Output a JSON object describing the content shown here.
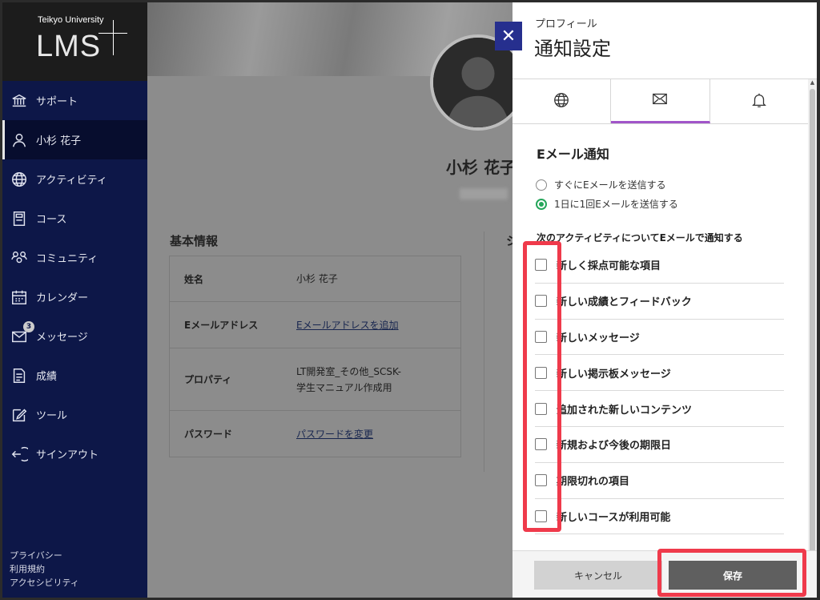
{
  "logo": {
    "small": "Teikyo University",
    "big": "LMS"
  },
  "sidebar": {
    "items": [
      {
        "label": "サポート",
        "icon": "institution-icon"
      },
      {
        "label": "小杉 花子",
        "icon": "user-icon"
      },
      {
        "label": "アクティビティ",
        "icon": "globe-icon"
      },
      {
        "label": "コース",
        "icon": "course-icon"
      },
      {
        "label": "コミュニティ",
        "icon": "community-icon"
      },
      {
        "label": "カレンダー",
        "icon": "calendar-icon"
      },
      {
        "label": "メッセージ",
        "icon": "mail-icon",
        "badge": "3"
      },
      {
        "label": "成績",
        "icon": "grades-icon"
      },
      {
        "label": "ツール",
        "icon": "tools-icon"
      },
      {
        "label": "サインアウト",
        "icon": "signout-icon"
      }
    ],
    "footer": [
      "プライバシー",
      "利用規約",
      "アクセシビリティ"
    ]
  },
  "profile": {
    "name": "小杉 花子",
    "section_title": "基本情報",
    "section_title_2": "シ",
    "rows": [
      {
        "label": "姓名",
        "value": "小杉 花子"
      },
      {
        "label": "Eメールアドレス",
        "value": "Eメールアドレスを追加"
      },
      {
        "label": "プロパティ",
        "value": "LT開発室_その他_SCSK-学生マニュアル作成用"
      },
      {
        "label": "パスワード",
        "value": "パスワードを変更"
      }
    ]
  },
  "panel": {
    "close": "✕",
    "subtitle": "プロフィール",
    "title": "通知設定",
    "tabs": [
      "globe-icon",
      "envelope-icon",
      "bell-icon"
    ],
    "active_tab": 1,
    "email_heading": "Eメール通知",
    "radio_options": [
      "すぐにEメールを送信する",
      "1日に1回Eメールを送信する"
    ],
    "radio_selected": 1,
    "activity_heading": "次のアクティビティについてEメールで通知する",
    "checkboxes": [
      "新しく採点可能な項目",
      "新しい成績とフィードバック",
      "新しいメッセージ",
      "新しい掲示板メッセージ",
      "追加された新しいコンテンツ",
      "新規および今後の期限日",
      "期限切れの項目",
      "新しいコースが利用可能"
    ],
    "cancel_label": "キャンセル",
    "save_label": "保存"
  },
  "colors": {
    "highlight": "#ef3a4b",
    "sidebar": "#0d1748",
    "radio_checked": "#26a65b",
    "tab_active": "#a155c9"
  }
}
